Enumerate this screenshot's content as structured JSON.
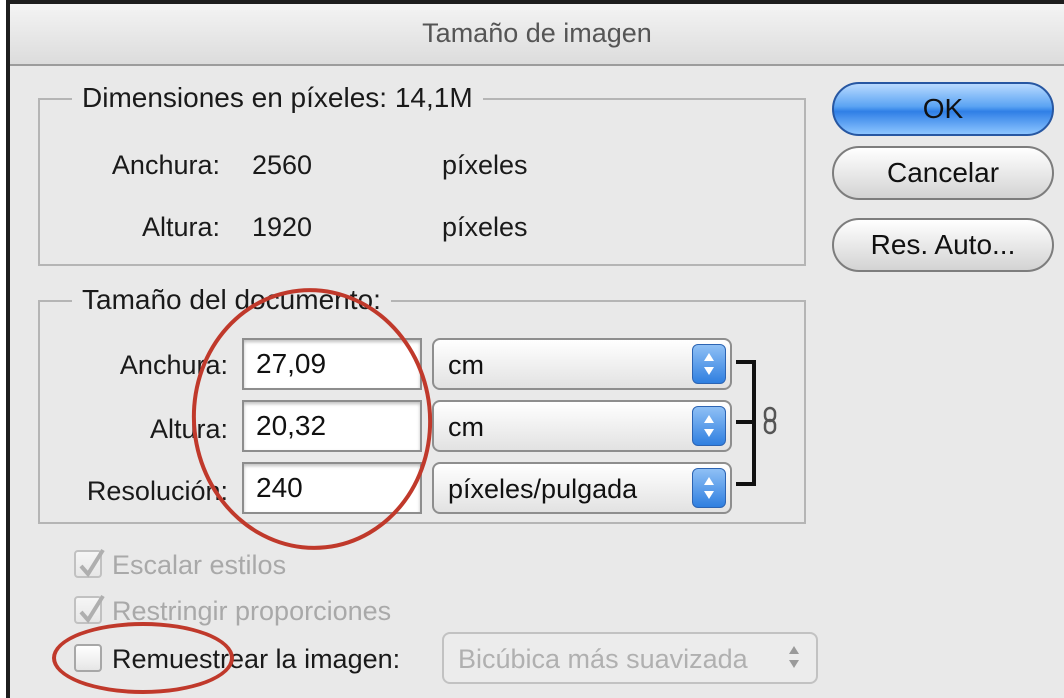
{
  "window": {
    "title": "Tamaño de imagen"
  },
  "pixel_dimensions": {
    "legend": "Dimensiones en píxeles: 14,1M",
    "width_label": "Anchura:",
    "width_value": "2560",
    "width_unit": "píxeles",
    "height_label": "Altura:",
    "height_value": "1920",
    "height_unit": "píxeles"
  },
  "document_size": {
    "legend": "Tamaño del documento:",
    "width_label": "Anchura:",
    "width_value": "27,09",
    "width_unit": "cm",
    "height_label": "Altura:",
    "height_value": "20,32",
    "height_unit": "cm",
    "resolution_label": "Resolución:",
    "resolution_value": "240",
    "resolution_unit": "píxeles/pulgada"
  },
  "buttons": {
    "ok": "OK",
    "cancel": "Cancelar",
    "auto": "Res. Auto..."
  },
  "options": {
    "scale_styles": {
      "label": "Escalar estilos",
      "checked": true,
      "enabled": false
    },
    "constrain": {
      "label": "Restringir proporciones",
      "checked": true,
      "enabled": false
    },
    "resample": {
      "label": "Remuestrear la imagen:",
      "checked": false,
      "enabled": true
    },
    "resample_method": "Bicúbica más suavizada"
  },
  "colors": {
    "highlight_oval": "#c0392b",
    "default_button": "#2f7fe6"
  }
}
